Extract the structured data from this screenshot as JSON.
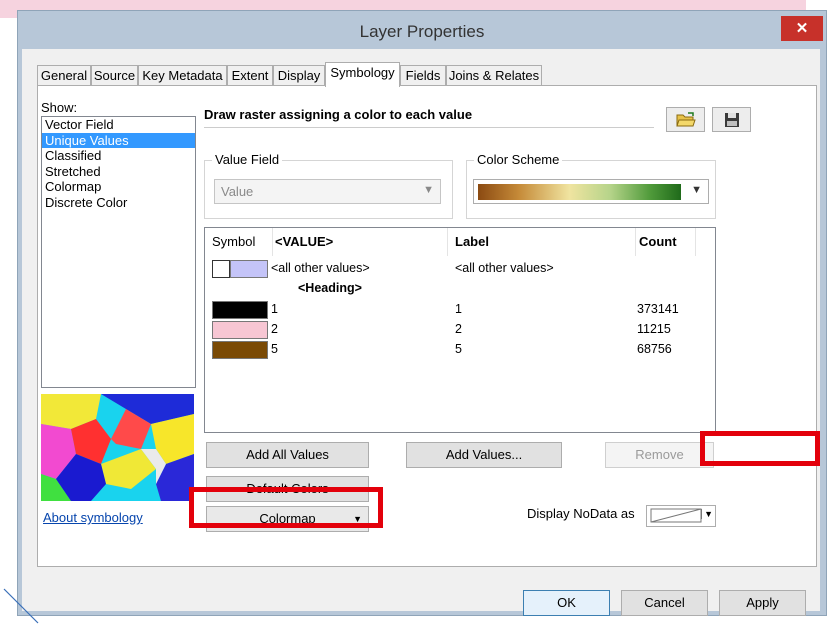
{
  "window": {
    "title": "Layer Properties",
    "close_glyph": "✕"
  },
  "tabs": [
    {
      "label": "General"
    },
    {
      "label": "Source"
    },
    {
      "label": "Key Metadata"
    },
    {
      "label": "Extent"
    },
    {
      "label": "Display"
    },
    {
      "label": "Symbology",
      "active": true
    },
    {
      "label": "Fields"
    },
    {
      "label": "Joins & Relates"
    }
  ],
  "show": {
    "label": "Show:",
    "items": [
      "Vector Field",
      "Unique Values",
      "Classified",
      "Stretched",
      "Colormap",
      "Discrete Color"
    ],
    "selected": "Unique Values"
  },
  "description": "Draw raster assigning a color to each value",
  "icons": {
    "open": "folder-open-icon",
    "save": "floppy-disk-icon"
  },
  "value_field": {
    "label": "Value Field",
    "value": "Value"
  },
  "color_scheme": {
    "label": "Color Scheme"
  },
  "table": {
    "headers": {
      "symbol": "Symbol",
      "value": "<VALUE>",
      "label": "Label",
      "count": "Count"
    },
    "other_row": {
      "value": "<all other values>",
      "label": "<all other values>",
      "color": "#c4c4f8"
    },
    "heading": "<Heading>",
    "rows": [
      {
        "value": "1",
        "label": "1",
        "count": "373141",
        "color": "#000000"
      },
      {
        "value": "2",
        "label": "2",
        "count": "11215",
        "color": "#f7c6d3"
      },
      {
        "value": "5",
        "label": "5",
        "count": "68756",
        "color": "#7a4a05"
      }
    ]
  },
  "buttons": {
    "add_all": "Add All Values",
    "add_values": "Add Values...",
    "remove": "Remove",
    "default_colors": "Default Colors",
    "colormap": "Colormap"
  },
  "about_link": "About symbology",
  "nodata": {
    "label": "Display NoData as"
  },
  "footer": {
    "ok": "OK",
    "cancel": "Cancel",
    "apply": "Apply"
  }
}
